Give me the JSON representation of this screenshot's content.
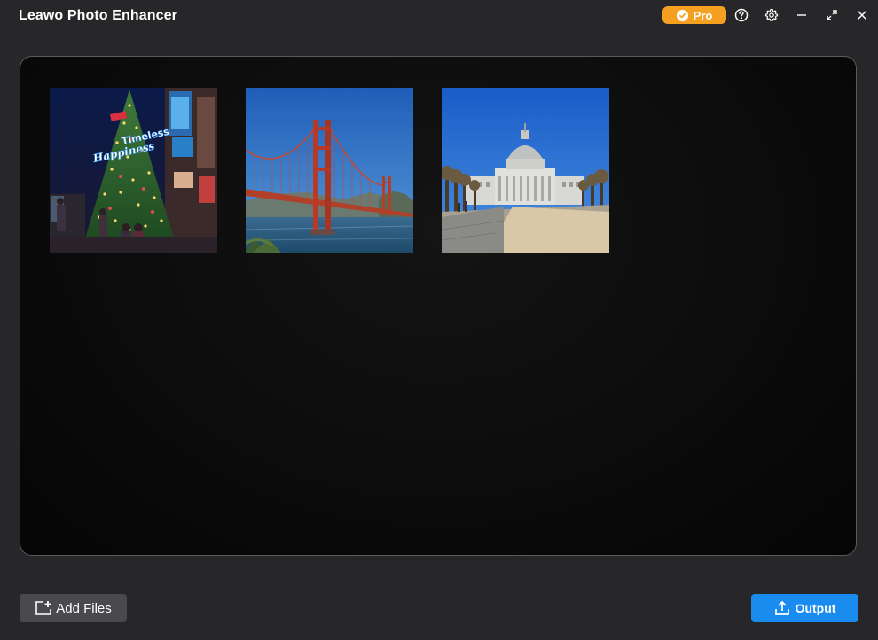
{
  "app": {
    "title": "Leawo Photo Enhancer"
  },
  "titlebar": {
    "pro_label": "Pro",
    "icons": [
      "check-icon",
      "help-icon",
      "gear-icon",
      "minimize-icon",
      "expand-icon",
      "close-icon"
    ]
  },
  "thumbnails": [
    {
      "name": "christmas-tree-photo",
      "text": "Timeless Happiness"
    },
    {
      "name": "golden-gate-bridge-photo"
    },
    {
      "name": "city-hall-photo"
    }
  ],
  "footer": {
    "add_files_label": "Add Files",
    "output_label": "Output"
  },
  "colors": {
    "background": "#27272a",
    "pro_accent": "#f5a020",
    "output_accent": "#1a8cf0",
    "add_button": "#4a4a4e"
  }
}
